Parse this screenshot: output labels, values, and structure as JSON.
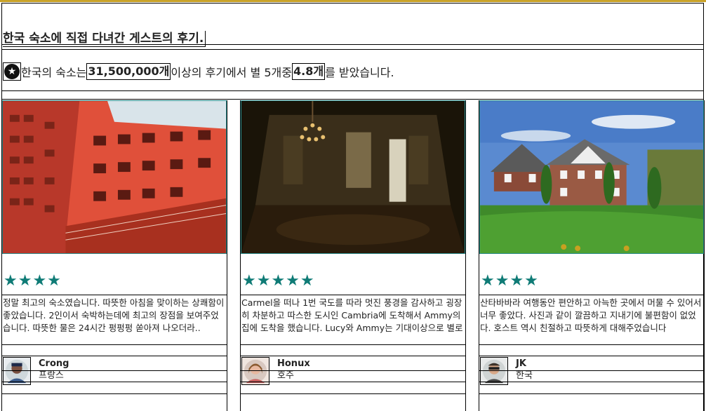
{
  "header": {
    "title": "한국 숙소에 직접 다녀간 게스트의 후기.",
    "summary_prefix": "한국의 숙소는 ",
    "review_count": "31,500,000개",
    "summary_middle": " 이상의 후기에서 별 5개중 ",
    "rating": "4.8개",
    "summary_suffix": "를 받았습니다.",
    "badge_icon": "star-circle-icon"
  },
  "colors": {
    "star": "#0f7b76",
    "accent_bar": "#c9a227",
    "photo_border": "#2a8c8c"
  },
  "reviews": [
    {
      "stars": "★★★★",
      "rating_value": 4,
      "text": "정말 최고의 숙소였습니다. 따뜻한 아침을 맞이하는 상쾌함이 좋았습니다. 2인이서 숙박하는데에 최고의 장점을 보여주었습니다. 따뜻한 물은 24시간 펑펑펑 쏟아져 나오더라..",
      "name": "Crong",
      "country": "프랑스",
      "photo": "red-apartment-building-photo",
      "avatar": "user-avatar-icon"
    },
    {
      "stars": "★★★★★",
      "rating_value": 5,
      "text": "Carmel을 떠나 1번 국도를 따라 멋진 풍경을 감사하고 굉장히 차분하고 따스한 도시인 Cambria에 도착해서 Ammy의 집에 도착을 했습니다. Lucy와 Ammy는 기대이상으로 별로",
      "name": "Honux",
      "country": "호주",
      "photo": "dark-chandelier-room-photo",
      "avatar": "user-avatar-icon"
    },
    {
      "stars": "★★★★",
      "rating_value": 4,
      "text": "산타바바라 여행동안 편안하고 아늑한 곳에서 머물 수 있어서 너무 좋았다. 사진과 같이 깔끔하고 지내기에 불편함이 없었다. 호스트 역시 친절하고 따뜻하게 대해주었습니다",
      "name": "JK",
      "country": "한국",
      "photo": "suburban-house-photo",
      "avatar": "user-avatar-icon"
    }
  ]
}
